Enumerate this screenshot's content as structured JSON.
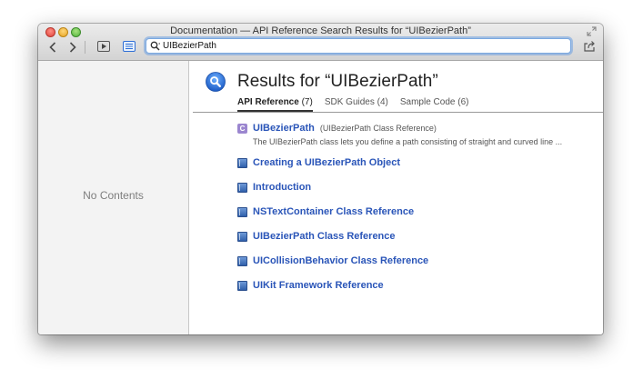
{
  "window": {
    "title": "Documentation — API Reference Search Results for “UIBezierPath”"
  },
  "toolbar": {
    "search_value": "UIBezierPath",
    "icons": {
      "back": "chevron-left-icon",
      "forward": "chevron-right-icon",
      "play": "play-icon",
      "list": "list-icon",
      "search": "search-icon",
      "share": "share-icon",
      "fullscreen": "fullscreen-icon"
    }
  },
  "sidebar": {
    "empty_label": "No Contents"
  },
  "results": {
    "heading": "Results for “UIBezierPath”",
    "tabs": [
      {
        "label": "API Reference",
        "count": "(7)",
        "active": true
      },
      {
        "label": "SDK Guides",
        "count": "(4)",
        "active": false
      },
      {
        "label": "Sample Code",
        "count": "(6)",
        "active": false
      }
    ],
    "top_result": {
      "badge": "C",
      "title": "UIBezierPath",
      "subtitle": "(UIBezierPath Class Reference)",
      "description": "The UIBezierPath class lets you define a path consisting of straight and curved line ..."
    },
    "items": [
      {
        "label": "Creating a UIBezierPath Object"
      },
      {
        "label": "Introduction"
      },
      {
        "label": "NSTextContainer Class Reference"
      },
      {
        "label": "UIBezierPath Class Reference"
      },
      {
        "label": "UICollisionBehavior Class Reference"
      },
      {
        "label": "UIKit Framework Reference"
      }
    ]
  },
  "colors": {
    "link": "#2a55b8",
    "accent": "#2f6fd6",
    "class_badge": "#9b86cf"
  }
}
